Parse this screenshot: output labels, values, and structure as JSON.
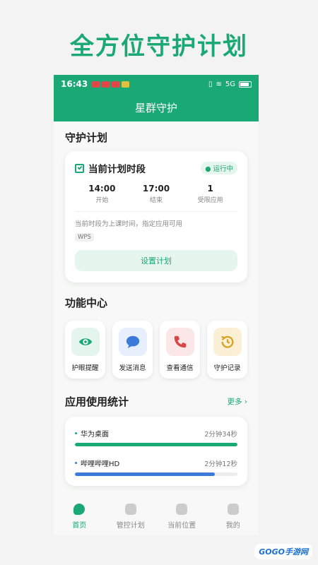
{
  "banner": {
    "title": "全方位守护计划"
  },
  "status_bar": {
    "time": "16:43",
    "network": "5G"
  },
  "appbar": {
    "title": "星群守护"
  },
  "plan_section": {
    "title": "守护计划",
    "card_title": "当前计划时段",
    "status_badge": "● 运行中",
    "stats": [
      {
        "value": "14:00",
        "label": "开始"
      },
      {
        "value": "17:00",
        "label": "结束"
      },
      {
        "value": "1",
        "label": "受限应用"
      }
    ],
    "description": "当前时段为上课时间，指定应用可用",
    "app_tag": "WPS",
    "button_label": "设置计划"
  },
  "function_section": {
    "title": "功能中心",
    "items": [
      {
        "label": "护眼提醒",
        "icon": "eye-icon",
        "bg": "#e3f5ec"
      },
      {
        "label": "发送消息",
        "icon": "message-icon",
        "bg": "#e6effb"
      },
      {
        "label": "查看通信",
        "icon": "phone-icon",
        "bg": "#fbe7e7"
      },
      {
        "label": "守护记录",
        "icon": "history-icon",
        "bg": "#fbf0d6"
      }
    ]
  },
  "usage_section": {
    "title": "应用使用统计",
    "more_label": "更多 ›",
    "apps": [
      {
        "name": "华为桌面",
        "time": "2分钟34秒",
        "fraction": 1.0,
        "color": "#1aa874"
      },
      {
        "name": "哔哩哔哩HD",
        "time": "2分钟12秒",
        "fraction": 0.86,
        "color": "#3b7ad9"
      }
    ]
  },
  "tabbar": {
    "tabs": [
      {
        "label": "首页",
        "active": true
      },
      {
        "label": "管控计划",
        "active": false
      },
      {
        "label": "当前位置",
        "active": false
      },
      {
        "label": "我的",
        "active": false
      }
    ]
  },
  "watermark": {
    "text": "GOGO手游网"
  },
  "colors": {
    "primary": "#1aa874",
    "secondary": "#3b7ad9"
  }
}
